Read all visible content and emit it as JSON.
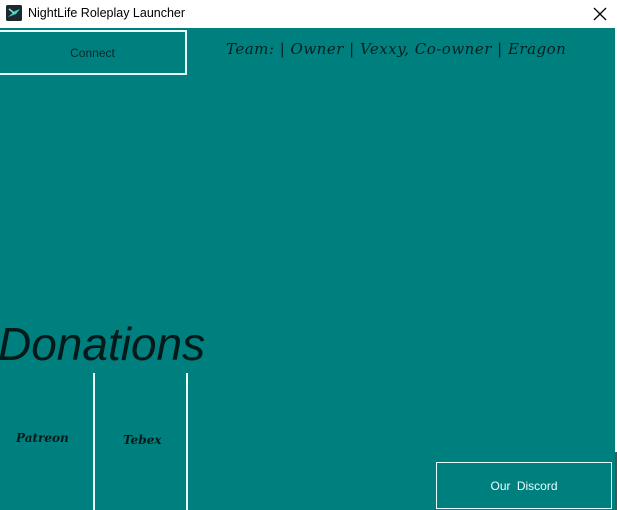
{
  "window": {
    "title": "NightLife Roleplay Launcher",
    "icon": "app-icon",
    "close_glyph": "✕"
  },
  "header": {
    "connect_label": "Connect",
    "team_text": "Team: |   Owner | Vexxy,  Co-owner | Eragon"
  },
  "donations": {
    "title": "Donations",
    "links": [
      {
        "label": "Patreon"
      },
      {
        "label": "Tebex"
      }
    ]
  },
  "footer": {
    "discord_label": "Our  Discord"
  },
  "colors": {
    "background": "#007f7f",
    "border": "#e8ffff",
    "text_dark": "#041a1a"
  }
}
